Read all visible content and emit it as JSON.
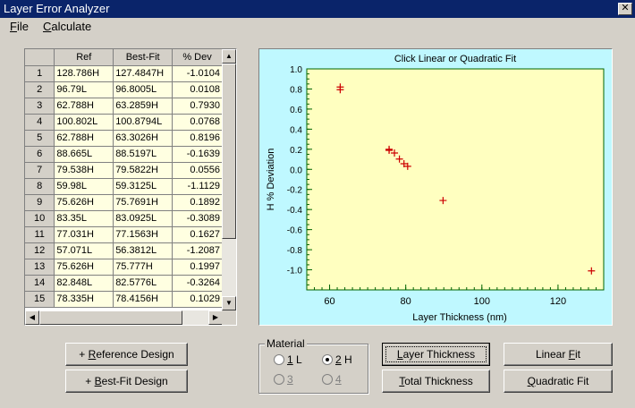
{
  "window": {
    "title": "Layer Error Analyzer",
    "close_glyph": "✕"
  },
  "menu": {
    "file": "File",
    "calculate": "Calculate"
  },
  "table": {
    "headers": [
      "Ref",
      "Best-Fit",
      "% Dev"
    ],
    "rows": [
      [
        "1",
        "128.786H",
        "127.4847H",
        "-1.0104"
      ],
      [
        "2",
        "96.79L",
        "96.8005L",
        "0.0108"
      ],
      [
        "3",
        "62.788H",
        "63.2859H",
        "0.7930"
      ],
      [
        "4",
        "100.802L",
        "100.8794L",
        "0.0768"
      ],
      [
        "5",
        "62.788H",
        "63.3026H",
        "0.8196"
      ],
      [
        "6",
        "88.665L",
        "88.5197L",
        "-0.1639"
      ],
      [
        "7",
        "79.538H",
        "79.5822H",
        "0.0556"
      ],
      [
        "8",
        "59.98L",
        "59.3125L",
        "-1.1129"
      ],
      [
        "9",
        "75.626H",
        "75.7691H",
        "0.1892"
      ],
      [
        "10",
        "83.35L",
        "83.0925L",
        "-0.3089"
      ],
      [
        "11",
        "77.031H",
        "77.1563H",
        "0.1627"
      ],
      [
        "12",
        "57.071L",
        "56.3812L",
        "-1.2087"
      ],
      [
        "13",
        "75.626H",
        "75.777H",
        "0.1997"
      ],
      [
        "14",
        "82.848L",
        "82.5776L",
        "-0.3264"
      ],
      [
        "15",
        "78.335H",
        "78.4156H",
        "0.1029"
      ]
    ]
  },
  "chart_data": {
    "type": "scatter",
    "title": "Click Linear or Quadratic Fit",
    "xlabel": "Layer Thickness (nm)",
    "ylabel": "H % Deviation",
    "xlim": [
      54,
      132
    ],
    "ylim": [
      -1.2,
      1.0
    ],
    "xticks": [
      60,
      80,
      100,
      120
    ],
    "yticks": [
      1.0,
      0.8,
      0.6,
      0.4,
      0.2,
      0.0,
      -0.2,
      -0.4,
      -0.6,
      -0.8,
      -1.0
    ],
    "ytick_labels": [
      "1.0",
      "0.8",
      "0.6",
      "0.4",
      "0.2",
      "0.0",
      "-0.2",
      "-0.4",
      "-0.6",
      "-0.8",
      "-1.0"
    ],
    "points": [
      {
        "x": 62.788,
        "y": 0.793
      },
      {
        "x": 62.788,
        "y": 0.8196
      },
      {
        "x": 75.626,
        "y": 0.1892
      },
      {
        "x": 75.626,
        "y": 0.1997
      },
      {
        "x": 77.031,
        "y": 0.1627
      },
      {
        "x": 78.335,
        "y": 0.1029
      },
      {
        "x": 79.538,
        "y": 0.0556
      },
      {
        "x": 80.5,
        "y": 0.03
      },
      {
        "x": 89.8,
        "y": -0.31
      },
      {
        "x": 128.786,
        "y": -1.0104
      }
    ],
    "marker_color": "#cc0000",
    "plot_bg": "#ffffc0",
    "frame_bg": "#bff8ff"
  },
  "buttons": {
    "ref_design": "+ Reference Design",
    "bestfit_design": "+ Best-Fit Design",
    "layer_thickness": "Layer Thickness",
    "total_thickness": "Total Thickness",
    "linear_fit": "Linear Fit",
    "quadratic_fit": "Quadratic Fit"
  },
  "material": {
    "legend": "Material",
    "options": [
      {
        "num": "1",
        "suffix": " L",
        "selected": false,
        "enabled": true
      },
      {
        "num": "2",
        "suffix": " H",
        "selected": true,
        "enabled": true
      },
      {
        "num": "3",
        "suffix": "",
        "selected": false,
        "enabled": false
      },
      {
        "num": "4",
        "suffix": "",
        "selected": false,
        "enabled": false
      }
    ]
  }
}
